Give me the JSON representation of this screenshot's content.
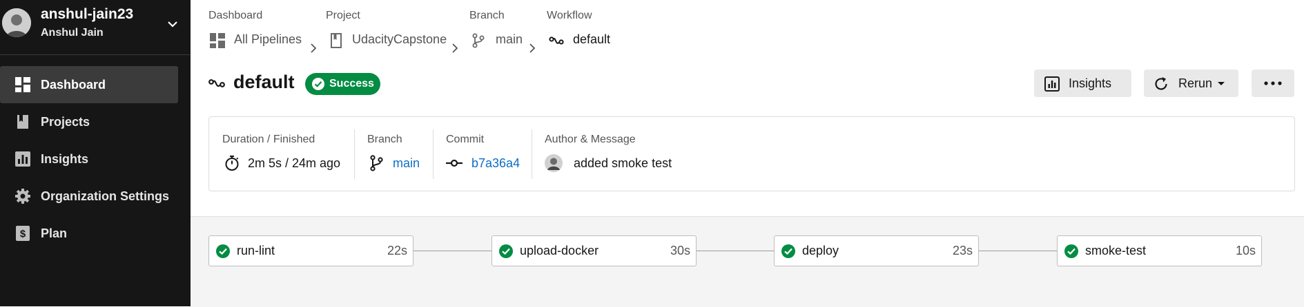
{
  "user": {
    "username": "anshul-jain23",
    "full_name": "Anshul Jain"
  },
  "sidebar": {
    "items": [
      {
        "label": "Dashboard",
        "icon": "dashboard-icon",
        "active": true
      },
      {
        "label": "Projects",
        "icon": "book-icon"
      },
      {
        "label": "Insights",
        "icon": "bar-chart-icon"
      },
      {
        "label": "Organization Settings",
        "icon": "gear-icon"
      },
      {
        "label": "Plan",
        "icon": "dollar-icon"
      }
    ]
  },
  "breadcrumb": {
    "dashboard": {
      "label": "Dashboard",
      "value": "All Pipelines"
    },
    "project": {
      "label": "Project",
      "value": "UdacityCapstone"
    },
    "branch": {
      "label": "Branch",
      "value": "main"
    },
    "workflow": {
      "label": "Workflow",
      "value": "default"
    }
  },
  "header": {
    "title": "default",
    "status": "Success",
    "insights_label": "Insights",
    "rerun_label": "Rerun"
  },
  "info": {
    "duration_label": "Duration / Finished",
    "duration_value": "2m 5s / 24m ago",
    "branch_label": "Branch",
    "branch_value": "main",
    "commit_label": "Commit",
    "commit_value": "b7a36a4",
    "author_label": "Author & Message",
    "message": "added smoke test"
  },
  "jobs": [
    {
      "name": "run-lint",
      "duration": "22s",
      "status": "success"
    },
    {
      "name": "upload-docker",
      "duration": "30s",
      "status": "success"
    },
    {
      "name": "deploy",
      "duration": "23s",
      "status": "success"
    },
    {
      "name": "smoke-test",
      "duration": "10s",
      "status": "success"
    }
  ],
  "colors": {
    "sidebar_bg": "#161616",
    "success": "#048c43",
    "link": "#0d6ec7",
    "workflow_bg": "#f4f4f4"
  }
}
